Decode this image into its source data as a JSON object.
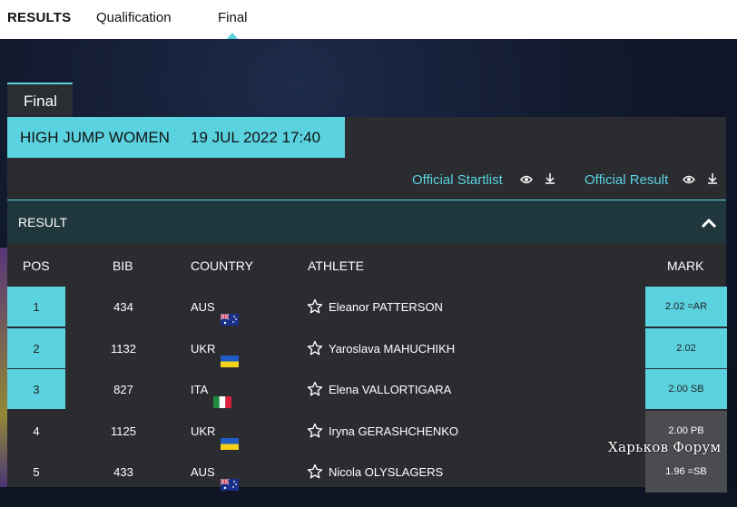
{
  "nav": {
    "results_label": "RESULTS",
    "qualification_label": "Qualification",
    "final_label": "Final"
  },
  "section_tab": "Final",
  "event": {
    "name": "HIGH JUMP WOMEN",
    "datetime": "19 JUL 2022 17:40"
  },
  "links": {
    "startlist_label": "Official Startlist",
    "result_label": "Official Result"
  },
  "result_section_label": "RESULT",
  "table": {
    "headers": {
      "pos": "POS",
      "bib": "BIB",
      "country": "COUNTRY",
      "athlete": "ATHLETE",
      "mark": "MARK"
    },
    "rows": [
      {
        "pos": "1",
        "bib": "434",
        "country": "AUS",
        "flag": "aus-flag",
        "athlete": "Eleanor PATTERSON",
        "mark": "2.02 =AR",
        "medal": true
      },
      {
        "pos": "2",
        "bib": "1132",
        "country": "UKR",
        "flag": "ukr-flag",
        "athlete": "Yaroslava MAHUCHIKH",
        "mark": "2.02",
        "medal": true
      },
      {
        "pos": "3",
        "bib": "827",
        "country": "ITA",
        "flag": "ita-flag",
        "athlete": "Elena VALLORTIGARA",
        "mark": "2.00 SB",
        "medal": true
      },
      {
        "pos": "4",
        "bib": "1125",
        "country": "UKR",
        "flag": "ukr-flag",
        "athlete": "Iryna GERASHCHENKO",
        "mark": "2.00 PB",
        "medal": false
      },
      {
        "pos": "5",
        "bib": "433",
        "country": "AUS",
        "flag": "aus-flag",
        "athlete": "Nicola OLYSLAGERS",
        "mark": "1.96 =SB",
        "medal": false
      }
    ]
  },
  "watermark": "Харьков Форум",
  "colors": {
    "accent": "#5bd2e0",
    "panel": "#2a2c30",
    "header_bar": "#20373e"
  }
}
